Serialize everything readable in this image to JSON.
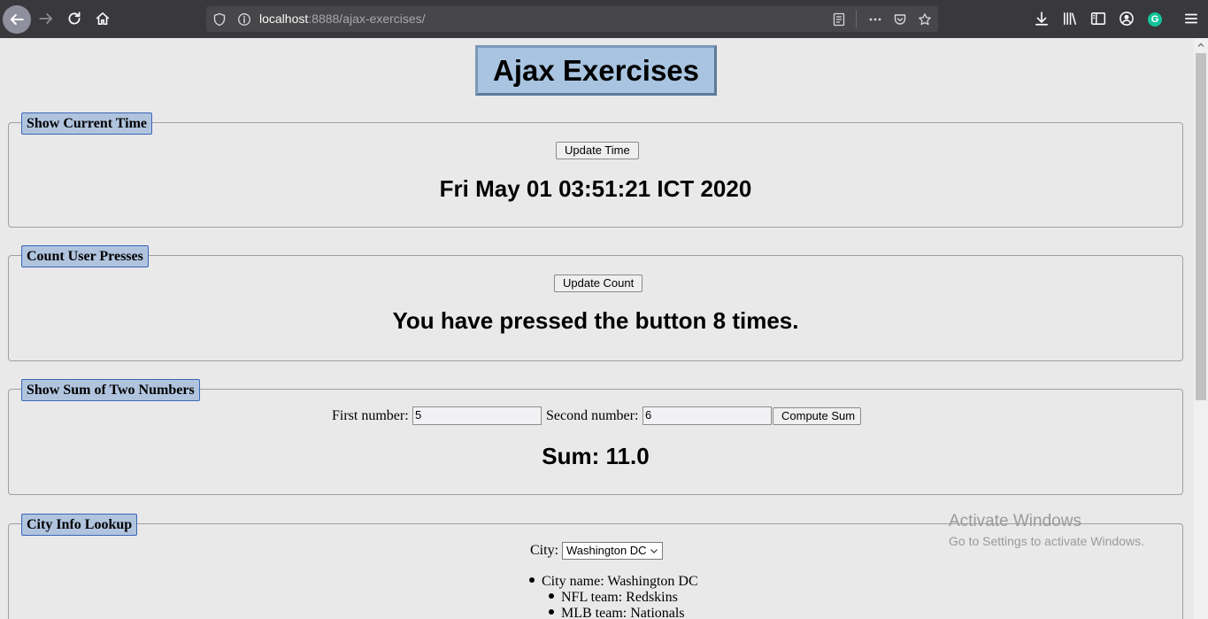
{
  "browser": {
    "url_host": "localhost",
    "url_rest": ":8888/ajax-exercises/",
    "grammarly_letter": "G",
    "icons": [
      "back-icon",
      "forward-icon",
      "reload-icon",
      "home-icon",
      "shield-icon",
      "info-icon",
      "reader-icon",
      "more-icon",
      "pocket-icon",
      "star-icon",
      "download-icon",
      "library-icon",
      "sidebar-icon",
      "account-icon",
      "grammarly-icon",
      "menu-icon"
    ]
  },
  "page": {
    "title": "Ajax Exercises"
  },
  "time_section": {
    "legend": "Show Current Time",
    "button": "Update Time",
    "result": "Fri May 01 03:51:21 ICT 2020"
  },
  "count_section": {
    "legend": "Count User Presses",
    "button": "Update Count",
    "result": "You have pressed the button 8 times."
  },
  "sum_section": {
    "legend": "Show Sum of Two Numbers",
    "first_label": "First number:",
    "first_value": "5",
    "second_label": "Second number:",
    "second_value": "6",
    "button": "Compute Sum",
    "result": "Sum: 11.0"
  },
  "city_section": {
    "legend": "City Info Lookup",
    "city_label": "City:",
    "city_selected": "Washington DC",
    "info": {
      "city_name": "City name: Washington DC",
      "nfl": "NFL team: Redskins",
      "mlb": "MLB team: Nationals"
    }
  },
  "watermark": {
    "line1": "Activate Windows",
    "line2": "Go to Settings to activate Windows."
  },
  "colors": {
    "legend_bg": "#b0c4de",
    "title_bg": "#a8c4e0",
    "page_bg": "#e9e9e9",
    "toolbar_bg": "#38383d"
  }
}
